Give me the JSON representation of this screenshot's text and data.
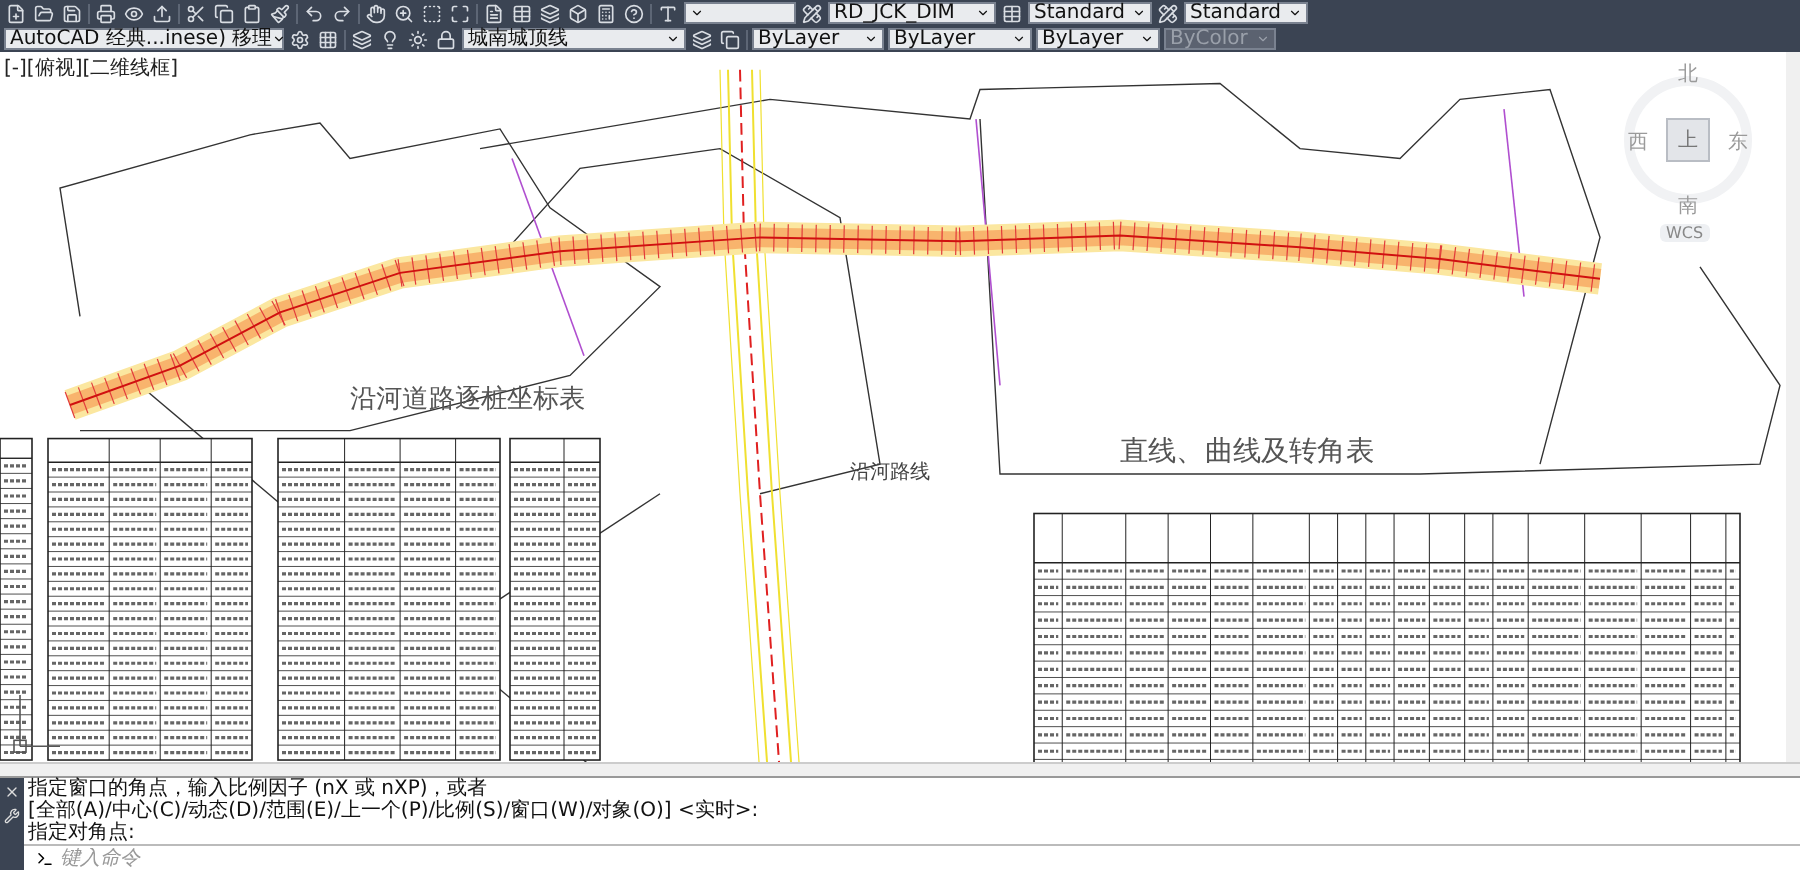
{
  "toolbar_top": {
    "dim_style": "RD_JCK_DIM",
    "table_style": "Standard",
    "multileader_style": "Standard"
  },
  "toolbar_second": {
    "workspace": "AutoCAD 经典...inese) 移理",
    "layer": "城南城顶线",
    "color_control": "ByLayer",
    "linetype": "ByLayer",
    "lineweight": "ByLayer",
    "plot_style": {
      "value": "ByColor",
      "disabled": true
    }
  },
  "viewport_label": "[-][俯视][二维线框]",
  "view_cube": {
    "north": "北",
    "south": "南",
    "east": "东",
    "west": "西",
    "top": "上",
    "ucs": "WCS"
  },
  "drawing": {
    "titles": [
      {
        "kind": "heading",
        "text": "沿河道路逐桩坐标表"
      },
      {
        "kind": "heading",
        "text": "直线、曲线及转角表"
      },
      {
        "kind": "label",
        "text": "沿河路线"
      }
    ]
  },
  "command_line": {
    "history": [
      "指定窗口的角点，输入比例因子 (nX 或 nXP)，或者",
      "[全部(A)/中心(C)/动态(D)/范围(E)/上一个(P)/比例(S)/窗口(W)/对象(O)] <实时>:",
      "指定对角点:"
    ],
    "placeholder": "键入命令"
  }
}
